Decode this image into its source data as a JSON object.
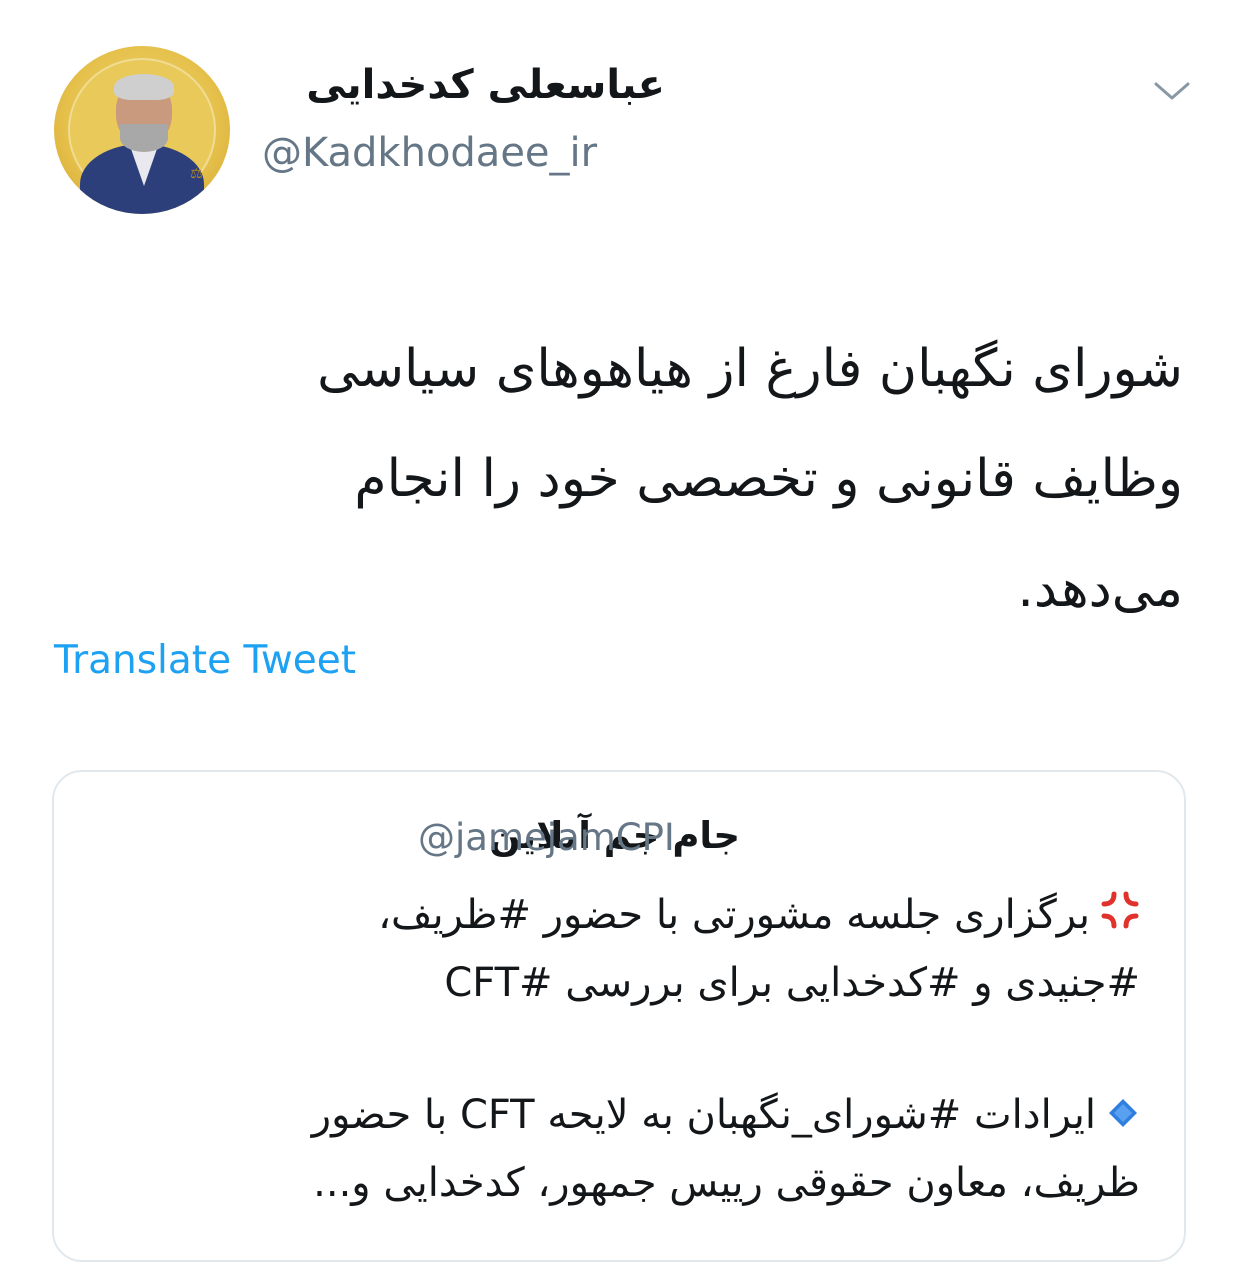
{
  "author": {
    "display_name": "عباسعلی کدخدایی",
    "handle": "@Kadkhodaee_ir"
  },
  "tweet": {
    "lines": [
      "شورای نگهبان فارغ از هیاهوهای سیاسی",
      "وظایف قانونی و تخصصی خود را انجام",
      "می‌دهد."
    ],
    "translate_label": "Translate Tweet"
  },
  "quoted_tweet": {
    "display_name": "جام جم آنلاین",
    "handle": "@jamejamCPI",
    "lines": [
      "برگزاری جلسه مشورتی با حضور #ظریف،",
      "#جنیدی و #کدخدایی برای بررسی #CFT",
      "ایرادات #شورای_نگهبان به لایحه CFT با حضور",
      "ظریف، معاون حقوقی رییس جمهور، کدخدایی و..."
    ]
  },
  "colors": {
    "link": "#1da1f2",
    "muted": "#657786",
    "border": "#e1e8ed",
    "angry_emoji": "#e0312b",
    "diamond_emoji": "#2f7fe0"
  },
  "icons": {
    "menu": "chevron-down-icon",
    "emoji_1": "anger-symbol-icon",
    "emoji_2": "small-blue-diamond-icon"
  }
}
